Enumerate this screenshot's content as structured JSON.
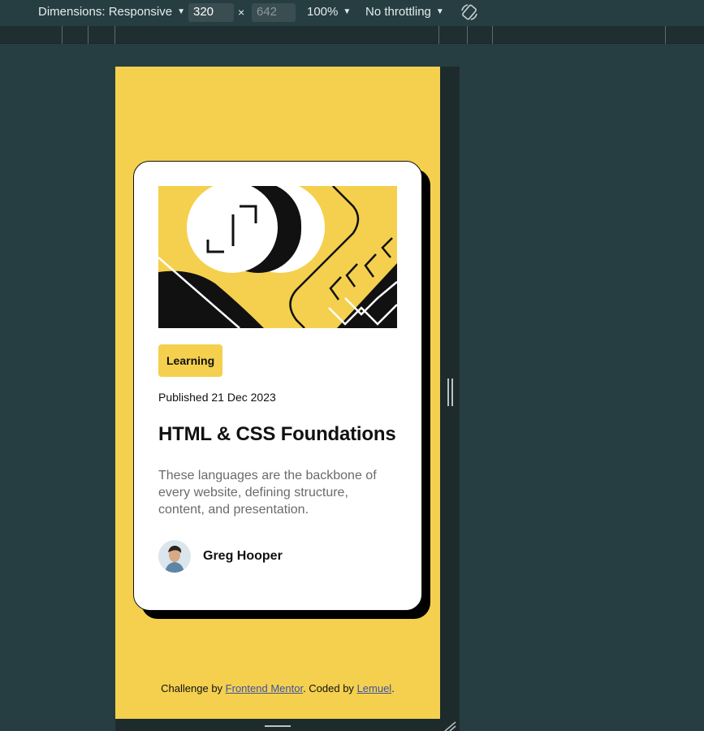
{
  "devtools": {
    "dimensions_label": "Dimensions: Responsive",
    "width": "320",
    "height_placeholder": "642",
    "times": "×",
    "zoom": "100%",
    "throttling": "No throttling",
    "rotate_icon": "rotate-icon",
    "caret_icon": "▼"
  },
  "card": {
    "image_alt": "illustration",
    "tag": "Learning",
    "published": "Published 21 Dec 2023",
    "title": "HTML & CSS Foundations",
    "description": "These languages are the backbone of every website, defining structure, content, and presentation.",
    "author": "Greg Hooper"
  },
  "attribution": {
    "prefix": "Challenge by ",
    "link1": "Frontend Mentor",
    "middle": ". Coded by ",
    "link2": "Lemuel",
    "suffix": "."
  },
  "colors": {
    "background_yellow": "#f4d04e",
    "devtools_bg": "#263e42",
    "card_bg": "#ffffff",
    "text_dark": "#111111",
    "text_grey": "#6b6b6b"
  }
}
